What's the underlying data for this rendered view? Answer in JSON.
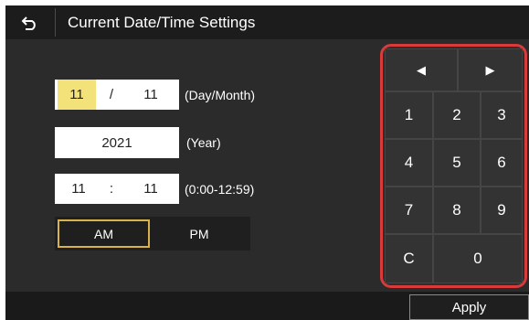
{
  "title": "Current Date/Time Settings",
  "date": {
    "day": "11",
    "separator": "/",
    "month": "11",
    "label": "(Day/Month)"
  },
  "year": {
    "value": "2021",
    "label": "(Year)"
  },
  "time": {
    "hour": "11",
    "separator": ":",
    "minute": "11",
    "label": "(0:00-12:59)"
  },
  "ampm": {
    "am": "AM",
    "pm": "PM",
    "selected": "AM"
  },
  "keypad": {
    "left": "◀",
    "right": "▶",
    "k1": "1",
    "k2": "2",
    "k3": "3",
    "k4": "4",
    "k5": "5",
    "k6": "6",
    "k7": "7",
    "k8": "8",
    "k9": "9",
    "clear": "C",
    "k0": "0"
  },
  "apply": "Apply",
  "colors": {
    "accent_frame": "#d93a3a",
    "selected_border": "#d9b24b",
    "cursor_highlight": "#f3e27a"
  }
}
